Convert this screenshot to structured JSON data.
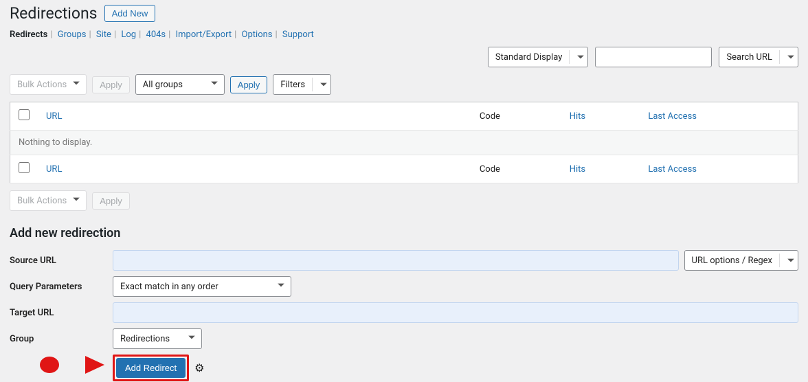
{
  "page": {
    "title": "Redirections",
    "add_new": "Add New"
  },
  "nav": {
    "items": [
      "Redirects",
      "Groups",
      "Site",
      "Log",
      "404s",
      "Import/Export",
      "Options",
      "Support"
    ]
  },
  "display": {
    "standard": "Standard Display",
    "search_url": "Search URL"
  },
  "toolbar": {
    "bulk_actions": "Bulk Actions",
    "apply": "Apply",
    "all_groups": "All groups",
    "filters": "Filters"
  },
  "table": {
    "url": "URL",
    "code": "Code",
    "hits": "Hits",
    "last_access": "Last Access",
    "empty": "Nothing to display."
  },
  "form": {
    "title": "Add new redirection",
    "source_url": "Source URL",
    "url_options": "URL options / Regex",
    "query_params": "Query Parameters",
    "query_params_value": "Exact match in any order",
    "target_url": "Target URL",
    "group": "Group",
    "group_value": "Redirections",
    "submit": "Add Redirect"
  }
}
